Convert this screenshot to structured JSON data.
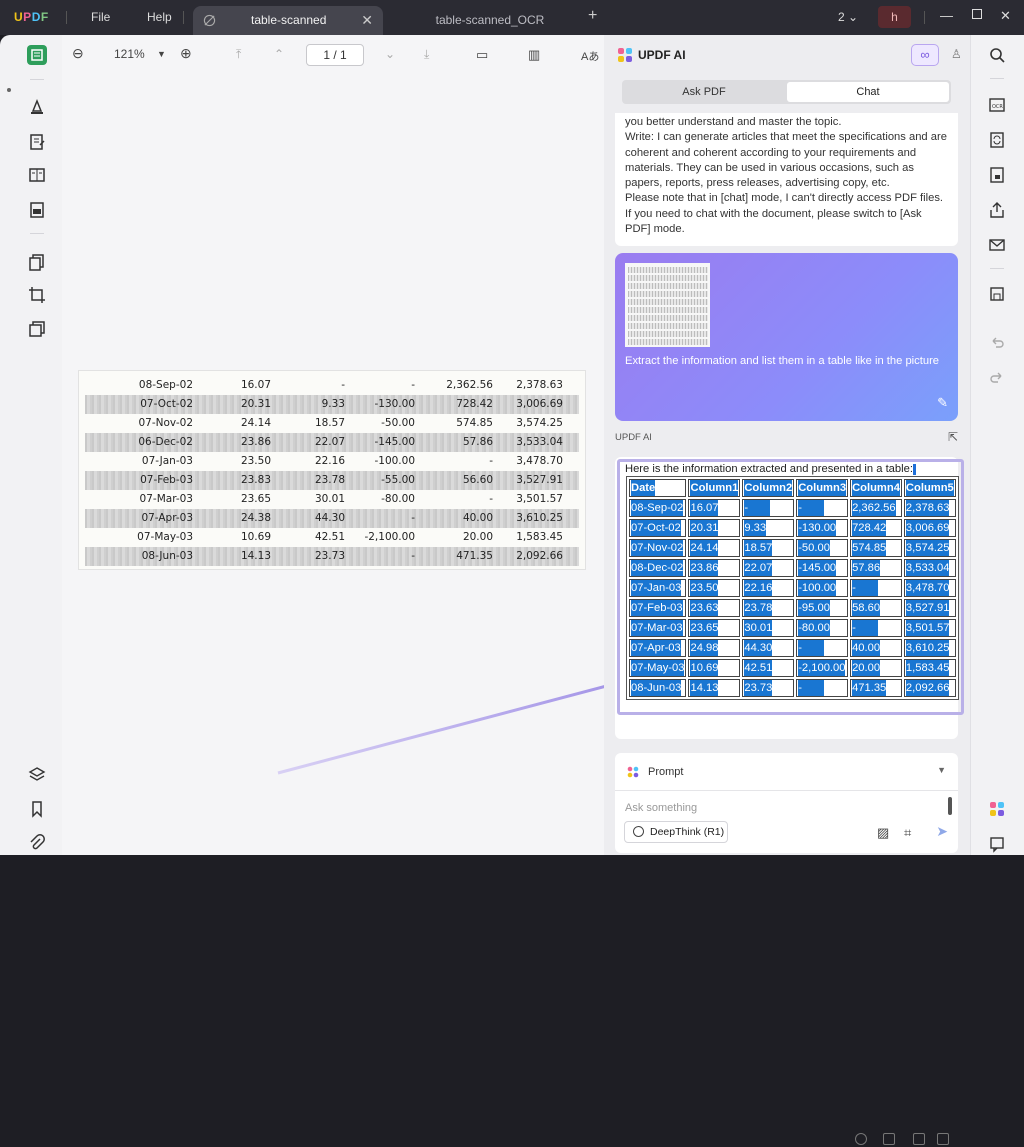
{
  "app": {
    "logo": "UPDF",
    "menu_file": "File",
    "menu_help": "Help",
    "tab_active": "table-scanned",
    "tab_inactive": "table-scanned_OCR",
    "window_count": "2",
    "avatar_letter": "h"
  },
  "toolbar": {
    "zoom": "121%",
    "page": "1 / 1"
  },
  "scan": {
    "rows": [
      [
        "08-Sep-02",
        "16.07",
        "-",
        "-",
        "2,362.56",
        "2,378.63"
      ],
      [
        "07-Oct-02",
        "20.31",
        "9.33",
        "-130.00",
        "728.42",
        "3,006.69"
      ],
      [
        "07-Nov-02",
        "24.14",
        "18.57",
        "-50.00",
        "574.85",
        "3,574.25"
      ],
      [
        "06-Dec-02",
        "23.86",
        "22.07",
        "-145.00",
        "57.86",
        "3,533.04"
      ],
      [
        "07-Jan-03",
        "23.50",
        "22.16",
        "-100.00",
        "-",
        "3,478.70"
      ],
      [
        "07-Feb-03",
        "23.83",
        "23.78",
        "-55.00",
        "56.60",
        "3,527.91"
      ],
      [
        "07-Mar-03",
        "23.65",
        "30.01",
        "-80.00",
        "-",
        "3,501.57"
      ],
      [
        "07-Apr-03",
        "24.38",
        "44.30",
        "-",
        "40.00",
        "3,610.25"
      ],
      [
        "07-May-03",
        "10.69",
        "42.51",
        "-2,100.00",
        "20.00",
        "1,583.45"
      ],
      [
        "08-Jun-03",
        "14.13",
        "23.73",
        "-",
        "471.35",
        "2,092.66"
      ]
    ]
  },
  "panel": {
    "title": "UPDF AI",
    "tab_ask": "Ask PDF",
    "tab_chat": "Chat",
    "msg1": {
      "p1": "you better understand and master the topic.",
      "p2": "Write: I can generate articles that meet the specifications and are coherent and coherent according to your requirements and materials. They can be used in various occasions, such as papers, reports, press releases, advertising copy, etc.",
      "p3": "Please note that in [chat] mode, I can't directly access PDF files. If you need to chat with the document, please switch to [Ask PDF] mode."
    },
    "user_msg": "Extract the information and list them in a table like in the picture",
    "ai_label": "UPDF AI",
    "ai_intro": "Here is the information extracted and presented in a table:",
    "table": {
      "headers": [
        "Date",
        "Column1",
        "Column2",
        "Column3",
        "Column4",
        "Column5"
      ],
      "rows": [
        [
          "08-Sep-02",
          "16.07",
          "-",
          "-",
          "2,362.56",
          "2,378.63"
        ],
        [
          "07-Oct-02",
          "20.31",
          "9.33",
          "-130.00",
          "728.42",
          "3,006.69"
        ],
        [
          "07-Nov-02",
          "24.14",
          "18.57",
          "-50.00",
          "574.85",
          "3,574.25"
        ],
        [
          "08-Dec-02",
          "23.86",
          "22.07",
          "-145.00",
          "57.86",
          "3,533.04"
        ],
        [
          "07-Jan-03",
          "23.50",
          "22.16",
          "-100.00",
          "-",
          "3,478.70"
        ],
        [
          "07-Feb-03",
          "23.63",
          "23.78",
          "-95.00",
          "58.60",
          "3,527.91"
        ],
        [
          "07-Mar-03",
          "23.65",
          "30.01",
          "-80.00",
          "-",
          "3,501.57"
        ],
        [
          "07-Apr-03",
          "24.98",
          "44.30",
          "-",
          "40.00",
          "3,610.25"
        ],
        [
          "07-May-03",
          "10.69",
          "42.51",
          "-2,100.00",
          "20.00",
          "1,583.45"
        ],
        [
          "08-Jun-03",
          "14.13",
          "23.73",
          "-",
          "471.35",
          "2,092.66"
        ]
      ]
    },
    "prompt_label": "Prompt",
    "ask_placeholder": "Ask something",
    "deepthink": "DeepThink (R1)"
  },
  "colors": {
    "accent": "#7c5ce0",
    "selection": "#1976d2"
  }
}
